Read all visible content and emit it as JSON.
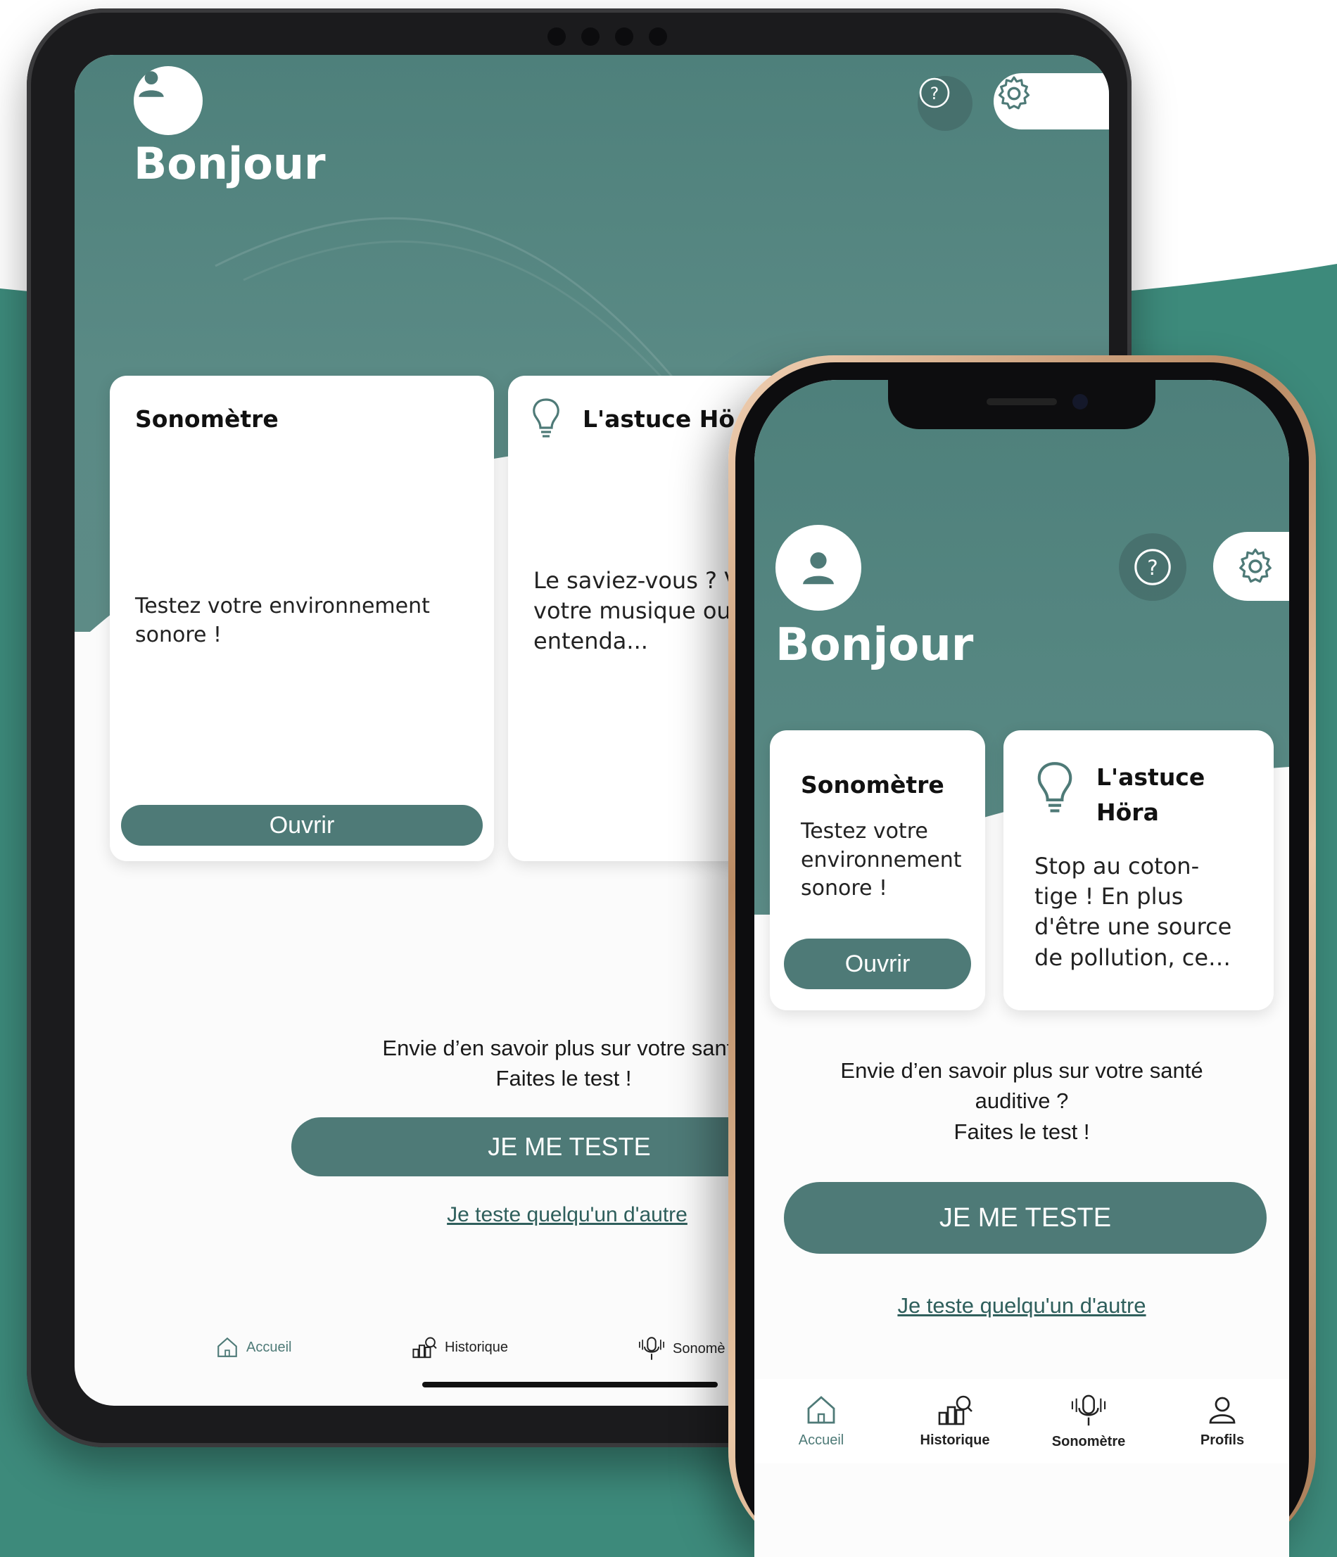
{
  "colors": {
    "brand": "#4e7a77",
    "header": "#568681",
    "background_wave": "#3d8a7b"
  },
  "tablet": {
    "greeting": "Bonjour",
    "icons": {
      "avatar": "user-icon",
      "help": "help-icon",
      "settings": "gear-icon"
    },
    "cards": {
      "sonometre": {
        "title": "Sonomètre",
        "text_line1": "Testez votre environnement",
        "text_line2": "sonore !",
        "button": "Ouvrir"
      },
      "astuce": {
        "title": "L'astuce Hö",
        "text_line1": "Le saviez-vous ? V",
        "text_line2": "votre musique ou",
        "text_line3": "entenda..."
      }
    },
    "prompt_line1": "Envie d’en savoir plus sur votre santé",
    "prompt_line2": "Faites le test !",
    "test_button": "JE ME TESTE",
    "other_link": "Je teste quelqu'un d'autre",
    "nav": {
      "home": "Accueil",
      "history": "Historique",
      "sonometer": "Sonomè"
    }
  },
  "phone": {
    "greeting": "Bonjour",
    "cards": {
      "sonometre": {
        "title": "Sonomètre",
        "text_line1": "Testez votre",
        "text_line2": "environnement",
        "text_line3": "sonore !",
        "button": "Ouvrir"
      },
      "astuce": {
        "title_line1": "L'astuce",
        "title_line2": "Höra",
        "text_line1": "Stop au coton-",
        "text_line2": "tige ! En plus",
        "text_line3": "d'être une source",
        "text_line4": "de pollution, ce…"
      }
    },
    "prompt_line1": "Envie d’en savoir plus sur votre santé",
    "prompt_line2": "auditive ?",
    "prompt_line3": "Faites le test !",
    "test_button": "JE ME TESTE",
    "other_link": "Je teste quelqu'un d'autre",
    "nav": {
      "home": "Accueil",
      "history": "Historique",
      "sonometer": "Sonomètre",
      "profiles": "Profils"
    }
  }
}
